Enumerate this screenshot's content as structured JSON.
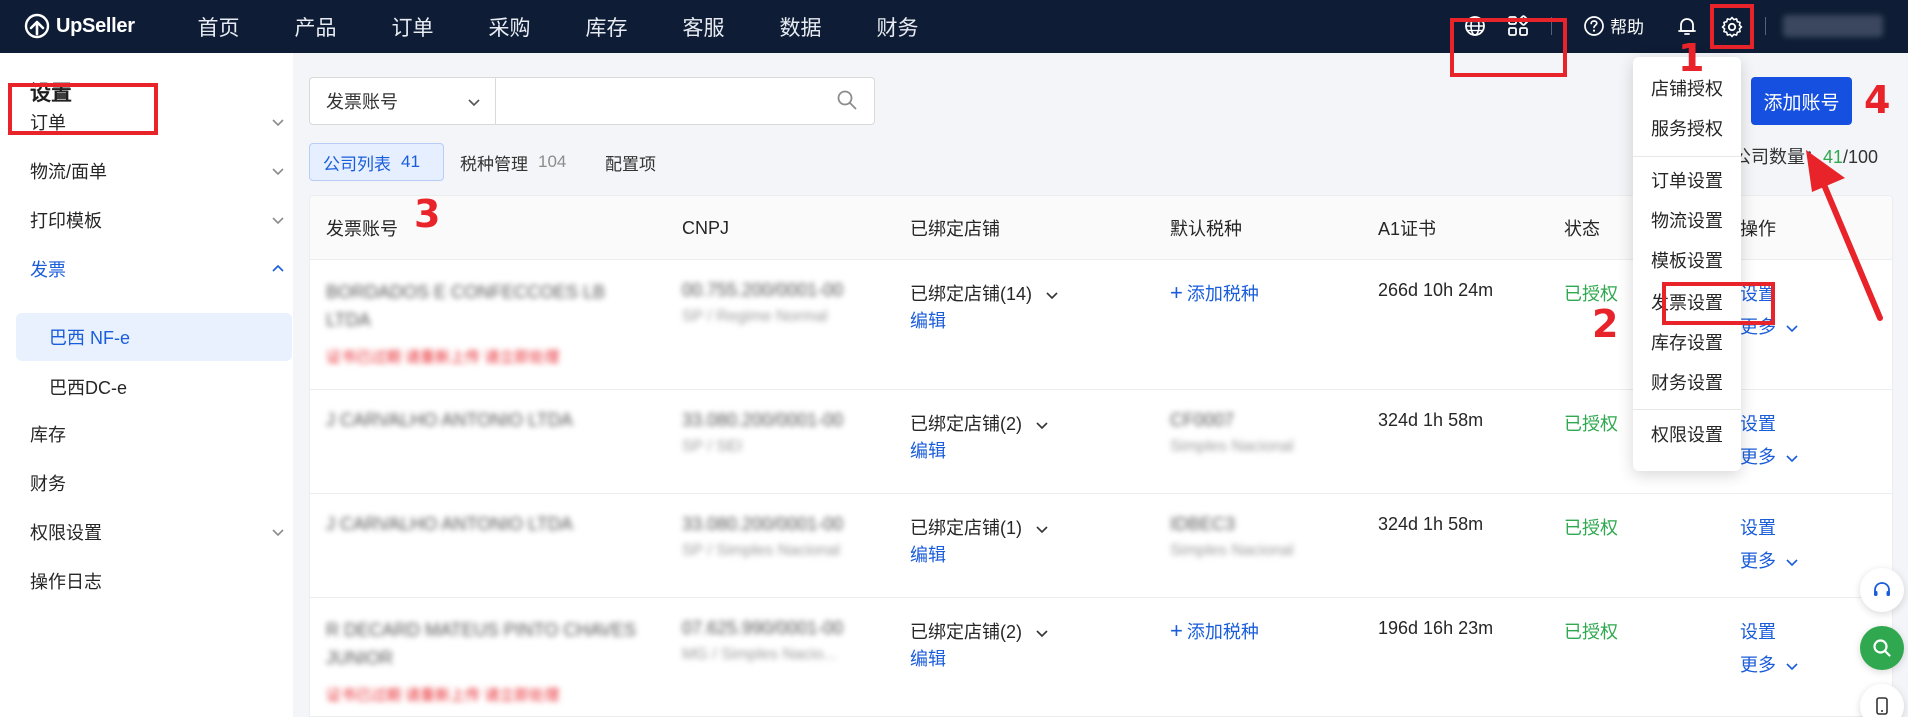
{
  "app": {
    "name": "UpSeller"
  },
  "nav": [
    "首页",
    "产品",
    "订单",
    "采购",
    "库存",
    "客服",
    "数据",
    "财务"
  ],
  "topbar": {
    "help_label": "帮助"
  },
  "sidebar": {
    "title": "设置",
    "items": [
      {
        "label": "订单",
        "expandable": true
      },
      {
        "label": "物流/面单",
        "expandable": true
      },
      {
        "label": "打印模板",
        "expandable": true
      },
      {
        "label": "发票",
        "expandable": true,
        "expanded": true
      },
      {
        "label": "库存",
        "expandable": false
      },
      {
        "label": "财务",
        "expandable": false
      },
      {
        "label": "权限设置",
        "expandable": true
      },
      {
        "label": "操作日志",
        "expandable": false
      }
    ],
    "sub_items": [
      "巴西 NF-e",
      "巴西DC-e"
    ]
  },
  "search": {
    "field_select": "发票账号",
    "placeholder": ""
  },
  "tabs": [
    {
      "label": "公司列表",
      "count": "41"
    },
    {
      "label": "税种管理",
      "count": "104"
    },
    {
      "label": "配置项",
      "count": ""
    }
  ],
  "actions": {
    "add_account": "添加账号"
  },
  "company_count": {
    "label": "公司数量：",
    "value": "41",
    "max": "/100"
  },
  "table": {
    "headers": [
      "发票账号",
      "CNPJ",
      "已绑定店铺",
      "默认税种",
      "A1证书",
      "状态",
      "操作"
    ],
    "rows": [
      {
        "account": "BORDADOS E CONFECCOES LB LTDA",
        "account_warning": "证书已过期 请重新上传 请立即处理",
        "cnpj": "00.755.200/0001-00",
        "cnpj_sub": "SP / Regime Normal",
        "bound": "已绑定店铺(14)",
        "edit": "编辑",
        "tax": "添加税种",
        "tax_sub": "",
        "tax_is_link": true,
        "cert": "266d 10h 24m",
        "status": "已授权",
        "op_set": "设置",
        "op_more": "更多"
      },
      {
        "account": "J CARVALHO ANTONIO LTDA",
        "account_warning": "",
        "cnpj": "33.080.200/0001-00",
        "cnpj_sub": "SP / SEI",
        "bound": "已绑定店铺(2)",
        "edit": "编辑",
        "tax": "CF0007",
        "tax_sub": "Simples Nacional",
        "tax_is_link": false,
        "cert": "324d 1h 58m",
        "status": "已授权",
        "op_set": "设置",
        "op_more": "更多"
      },
      {
        "account": "J CARVALHO ANTONIO LTDA",
        "account_warning": "",
        "cnpj": "33.080.200/0001-00",
        "cnpj_sub": "SP / Simples Nacional",
        "bound": "已绑定店铺(1)",
        "edit": "编辑",
        "tax": "IDBEC3",
        "tax_sub": "Simples Nacional",
        "tax_is_link": false,
        "cert": "324d 1h 58m",
        "status": "已授权",
        "op_set": "设置",
        "op_more": "更多"
      },
      {
        "account": "R DECARD MATEUS PINTO CHAVES JUNIOR",
        "account_warning": "证书已过期 请重新上传 请立即处理",
        "cnpj": "07.625.990/0001-00",
        "cnpj_sub": "MG / Simples Nacio...",
        "bound": "已绑定店铺(2)",
        "edit": "编辑",
        "tax": "添加税种",
        "tax_sub": "",
        "tax_is_link": true,
        "cert": "196d 16h 23m",
        "status": "已授权",
        "op_set": "设置",
        "op_more": "更多"
      }
    ]
  },
  "settings_menu": {
    "group1": [
      "店铺授权",
      "服务授权"
    ],
    "group2": [
      "订单设置",
      "物流设置",
      "模板设置",
      "发票设置",
      "库存设置",
      "财务设置"
    ],
    "group3": [
      "权限设置"
    ]
  },
  "annotations": {
    "m1": "1",
    "m2": "2",
    "m3": "3",
    "m4": "4",
    "color": "#e8232a"
  },
  "colors": {
    "topbar": "#0e1d35",
    "primary": "#1650e0",
    "success": "#2fa84f",
    "link": "#1a5ddb"
  }
}
